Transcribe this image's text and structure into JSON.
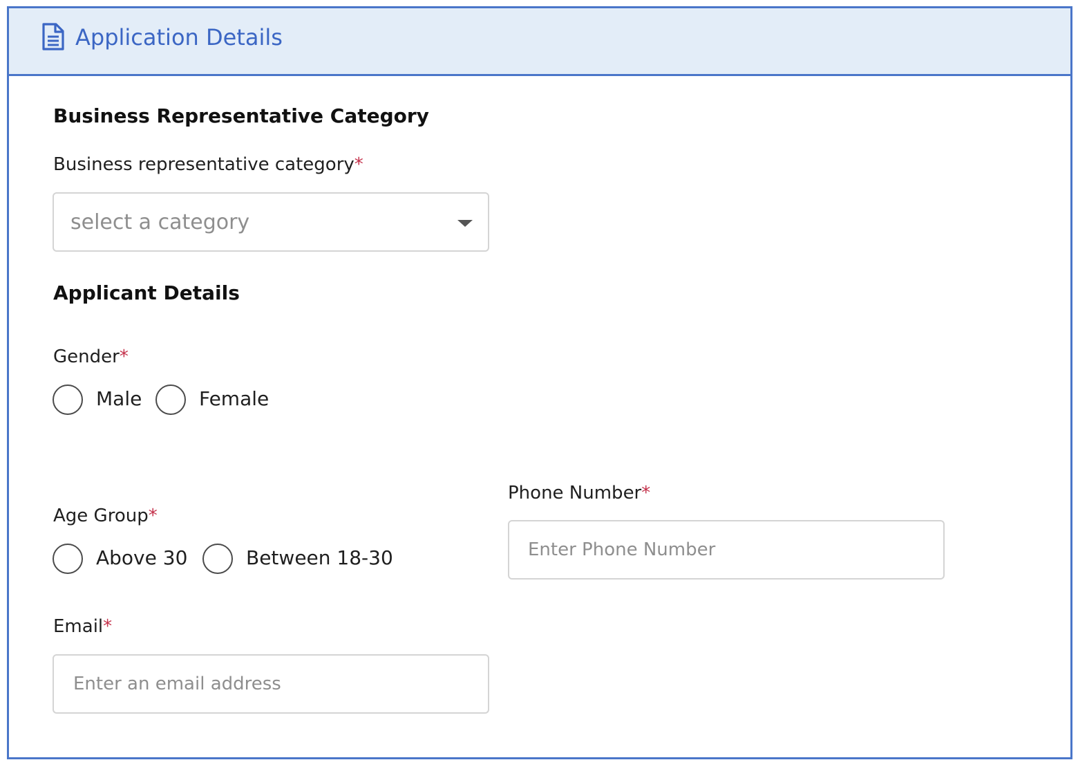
{
  "header": {
    "title": "Application Details",
    "icon": "document-icon",
    "accent_color": "#4a76c9"
  },
  "business_section": {
    "title": "Business Representative Category",
    "category_label": "Business representative category",
    "required_mark": "*",
    "category_placeholder": "select a category"
  },
  "applicant_section": {
    "title": "Applicant Details",
    "gender": {
      "label": "Gender",
      "required_mark": "*",
      "options": [
        "Male",
        "Female"
      ]
    },
    "age_group": {
      "label": "Age Group",
      "required_mark": "*",
      "options": [
        "Above 30",
        "Between 18-30"
      ]
    },
    "phone": {
      "label": "Phone Number",
      "required_mark": "*",
      "placeholder": "Enter Phone Number"
    },
    "email": {
      "label": "Email",
      "required_mark": "*",
      "placeholder": "Enter an email address"
    }
  }
}
